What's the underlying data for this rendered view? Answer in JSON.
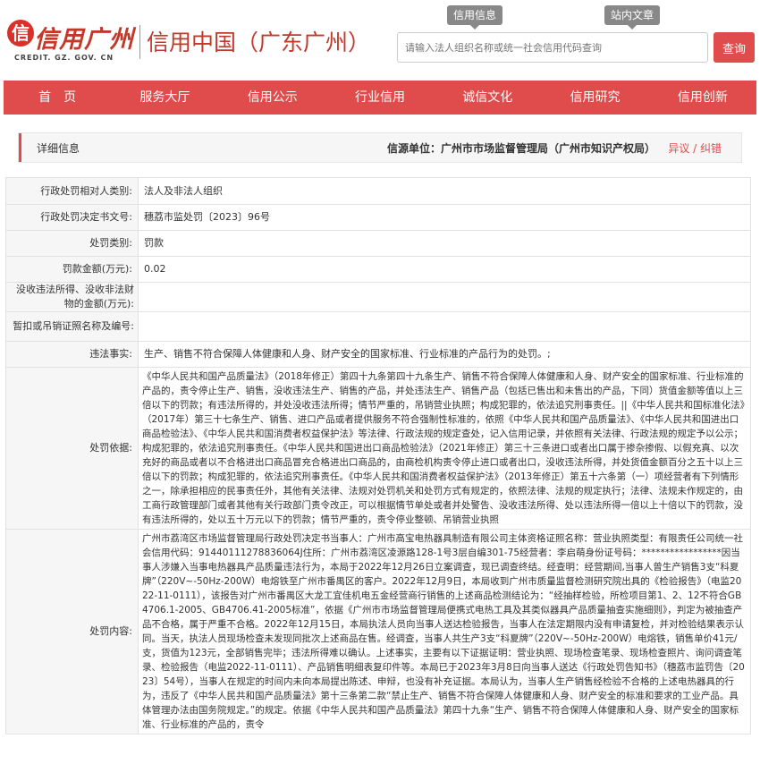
{
  "header": {
    "logo_mark": "信",
    "logo_cn": "信用广州",
    "logo_en": "CREDIT. GZ. GOV. CN",
    "logo_sub": "信用中国（广东广州）",
    "tab_info": "信用信息",
    "tab_site": "站内文章",
    "search_placeholder": "请输入法人组织名称或统一社会信用代码查询",
    "search_button": "查询"
  },
  "nav": [
    "首　页",
    "服务大厅",
    "信用公示",
    "行业信用",
    "诚信文化",
    "信用研究",
    "信用创新"
  ],
  "detail": {
    "title": "详细信息",
    "source": "信源单位：广州市市场监督管理局（广州市知识产权局）",
    "action": "异议 / 纠错"
  },
  "rows": [
    {
      "label": "行政处罚相对人类别:",
      "value": "法人及非法人组织"
    },
    {
      "label": "行政处罚决定书文号:",
      "value": "穗荔市监处罚〔2023〕96号"
    },
    {
      "label": "处罚类别:",
      "value": "罚款"
    },
    {
      "label": "罚款金额(万元):",
      "value": "0.02"
    },
    {
      "label": "没收违法所得、没收非法财物的金额(万元):",
      "value": ""
    },
    {
      "label": "暂扣或吊销证照名称及编号:",
      "value": ""
    },
    {
      "label": "违法事实:",
      "value": "生产、销售不符合保障人体健康和人身、财产安全的国家标准、行业标准的产品行为的处罚。;"
    },
    {
      "label": "处罚依据:",
      "value": "《中华人民共和国产品质量法》（2018年修正）第四十九条第四十九条生产、销售不符合保障人体健康和人身、财产安全的国家标准、行业标准的产品的，责令停止生产、销售，没收违法生产、销售的产品，并处违法生产、销售产品（包括已售出和未售出的产品，下同）货值金额等值以上三倍以下的罚款；有违法所得的，并处没收违法所得；情节严重的，吊销营业执照；构成犯罪的，依法追究刑事责任。||《中华人民共和国标准化法》（2017年）第三十七条生产、销售、进口产品或者提供服务不符合强制性标准的，依照《中华人民共和国产品质量法》、《中华人民共和国进出口商品检验法》、《中华人民共和国消费者权益保护法》等法律、行政法规的规定查处，记入信用记录，并依照有关法律、行政法规的规定予以公示；构成犯罪的，依法追究刑事责任。《中华人民共和国进出口商品检验法》（2021年修正）第三十三条进口或者出口属于掺杂掺假、以假充真、以次充好的商品或者以不合格进出口商品冒充合格进出口商品的，由商检机构责令停止进口或者出口，没收违法所得，并处货值金额百分之五十以上三倍以下的罚款；构成犯罪的，依法追究刑事责任。《中华人民共和国消费者权益保护法》（2013年修正）第五十六条第（一）项经营者有下列情形之一，除承担相应的民事责任外，其他有关法律、法规对处罚机关和处罚方式有规定的，依照法律、法规的规定执行；法律、法规未作规定的，由工商行政管理部门或者其他有关行政部门责令改正，可以根据情节单处或者并处警告、没收违法所得、处以违法所得一倍以上十倍以下的罚款，没有违法所得的，处以五十万元以下的罚款；情节严重的，责令停业整顿、吊销营业执照"
    },
    {
      "label": "处罚内容:",
      "value": "广州市荔湾区市场监督管理局行政处罚决定书当事人：广州市高宝电热器具制造有限公司主体资格证照名称：营业执照类型：有限责任公司统一社会信用代码：91440111278836064J住所：广州市荔湾区凌源路128-1号3层自编301-75经营者：李启萌身份证号码：*****************因当事人涉嫌入当事电热器具产品质量违法行为，本局于2022年12月26日立案调查，现已调查终结。经查明：经营期间,当事人曾生产销售3支“科夏牌”（220V~-50Hz-200W）电熔铁至广州市番禺区的客户。2022年12月9日，本局收到广州市质量监督检测研究院出具的《检验报告》（电监2022-11-0111），该报告对广州市番禺区大龙工宜佳机电五金经营商行销售的上述商品检测结论为：“经抽样检验，所检项目第1、2、12不符合GB4706.1-2005、GB4706.41-2005标准”，依据《广州市市场监督管理局便携式电热工具及其类似器具产品质量抽查实施细则》，判定为被抽查产品不合格，属于严重不合格。2022年12月15日，本局执法人员向当事人送达检验报告，当事人在法定期限内没有申请复检，并对检验结果表示认同。当天，执法人员现场检查未发现同批次上述商品在售。经调查，当事人共生产3支“科夏牌”（220V~-50Hz-200W）电熔铁，销售单价41元/支，货值为123元，全部销售完毕；违法所得难以确认。上述事实，主要有以下证据证明：营业执照、现场检查笔录、现场检查照片、询问调查笔录、检验报告（电监2022-11-0111）、产品销售明细表复印件等。本局已于2023年3月8日向当事人送达《行政处罚告知书》（穗荔市监罚告〔2023〕54号），当事人在规定的时间内未向本局提出陈述、申辩，也没有补充证据。本局认为，当事人生产销售经检验不合格的上述电热器具的行为，违反了《中华人民共和国产品质量法》第十三条第二款“禁止生产、销售不符合保障人体健康和人身、财产安全的标准和要求的工业产品。具体管理办法由国务院规定。”的规定。依据《中华人民共和国产品质量法》第四十九条“生产、销售不符合保障人体健康和人身、财产安全的国家标准、行业标准的产品的，责令"
    }
  ]
}
